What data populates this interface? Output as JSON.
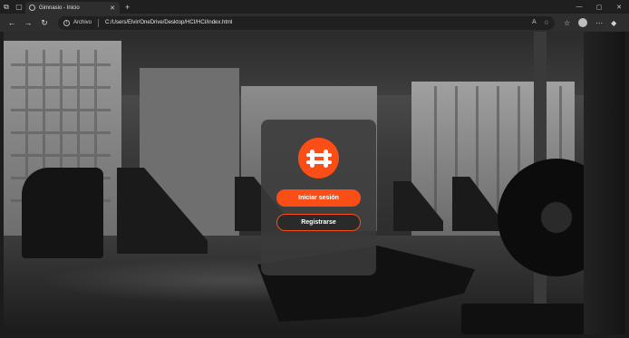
{
  "browser": {
    "tab_title": "Gimnasio - Inicio",
    "new_tab_label": "+",
    "address_scheme": "Archivo",
    "address_url": "C:/Users/Elvir/OneDrive/Desktop/HCI/HCI/index.html"
  },
  "page": {
    "login_button": "Iniciar sesión",
    "register_button": "Registrarse"
  },
  "colors": {
    "accent": "#fb4e16",
    "card_bg": "#3a3a3a"
  },
  "icons": {
    "logo": "gym-logo-icon"
  }
}
